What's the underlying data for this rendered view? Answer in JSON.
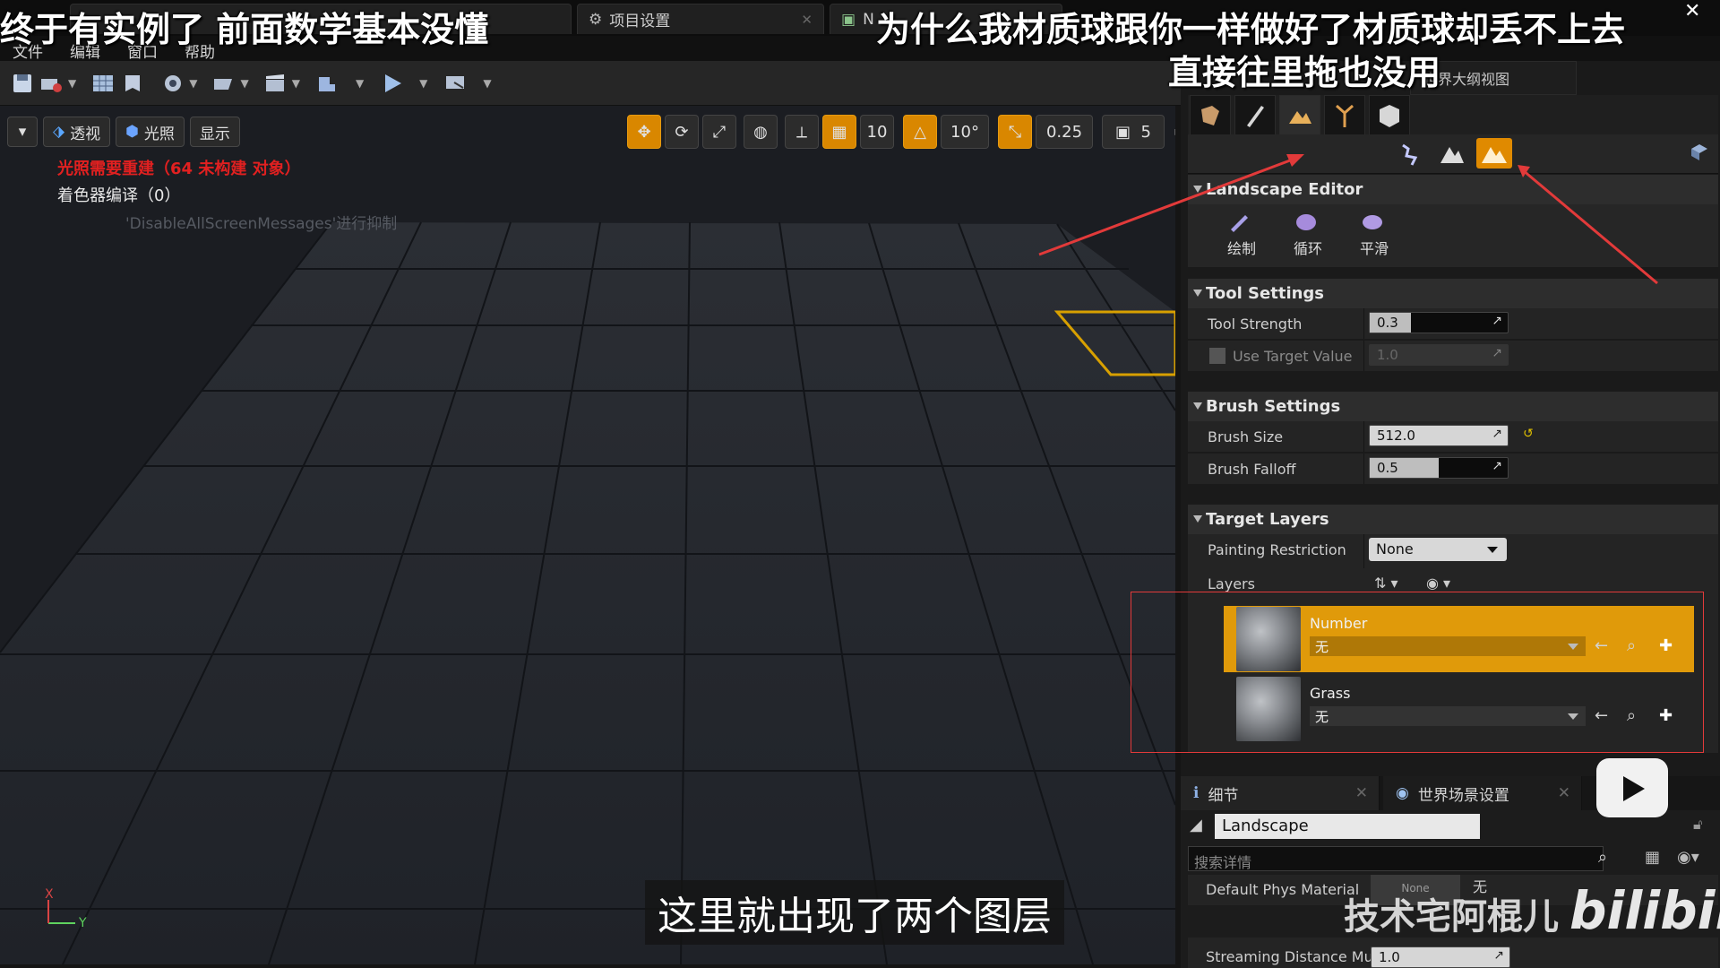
{
  "overlay": {
    "caption_top_left": "终于有实例了  前面数学基本没懂",
    "caption_top_right": "为什么我材质球跟你一样做好了材质球却丢不上去",
    "caption_top_right_2": "直接往里拖也没用",
    "subtitle": "这里就出现了两个图层",
    "watermark_user": "技术宅阿棍儿",
    "watermark_site": "bilibili"
  },
  "tabs": [
    {
      "label": "项目设置"
    },
    {
      "label": "N"
    }
  ],
  "menu": {
    "file": "文件",
    "edit": "编辑",
    "window": "窗口",
    "help": "帮助"
  },
  "viewport": {
    "perspective": "透视",
    "lighting": "光照",
    "show": "显示",
    "grid_snap": "10",
    "rot_snap": "10°",
    "scale_snap": "0.25",
    "camera_speed": "5",
    "warning": "光照需要重建（64 未构建 对象）",
    "shader_compile": "着色器编译（0）",
    "disable_msg": "'DisableAllScreenMessages'进行抑制",
    "axis_x": "X",
    "axis_y": "Y"
  },
  "outliner_tab": "世界大纲视图",
  "landscape": {
    "header": "Landscape Editor",
    "tools": {
      "sculpt": "绘制",
      "cycle": "循环",
      "smooth": "平滑"
    }
  },
  "tool_settings": {
    "header": "Tool Settings",
    "strength_label": "Tool Strength",
    "strength_value": "0.3",
    "strength_fraction": 0.3,
    "target_label": "Use Target Value",
    "target_value": "1.0"
  },
  "brush_settings": {
    "header": "Brush Settings",
    "size_label": "Brush Size",
    "size_value": "512.0",
    "falloff_label": "Brush Falloff",
    "falloff_value": "0.5",
    "falloff_fraction": 0.5
  },
  "target_layers": {
    "header": "Target Layers",
    "restriction_label": "Painting Restriction",
    "restriction_value": "None",
    "layers_label": "Layers",
    "layers": [
      {
        "name": "Number",
        "material": "无",
        "selected": true
      },
      {
        "name": "Grass",
        "material": "无",
        "selected": false
      }
    ]
  },
  "details": {
    "tab_details": "细节",
    "tab_world": "世界场景设置",
    "name": "Landscape",
    "search_placeholder": "搜索详情",
    "phys_label": "Default Phys Material",
    "phys_value": "None",
    "phys_extra": "无",
    "stream_label": "Streaming Distance Mu",
    "stream_value": "1.0"
  },
  "colors": {
    "accent": "#E09A0A",
    "warning": "#E12020",
    "annotation": "#E23A3A"
  }
}
